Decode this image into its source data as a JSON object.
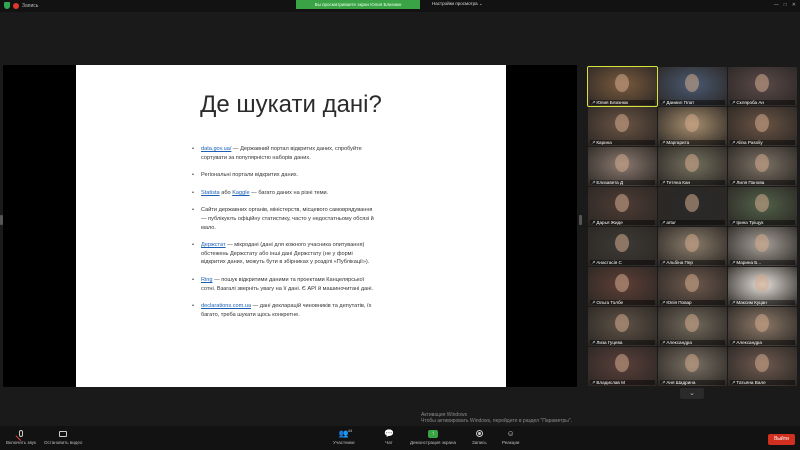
{
  "topbar": {
    "app_name": "Запись",
    "share_banner": "Вы просматриваете экран Юлия Близнюк",
    "view_options": "Настройки просмотра ⌄",
    "window_controls": [
      "—",
      "□",
      "✕"
    ]
  },
  "slide": {
    "title": "Де шукати дані?",
    "bullets": [
      {
        "link": "data.gov.ua/",
        "text": " — Державний портал відкритих даних, спробуйте сортувати за популярністю наборів даних."
      },
      {
        "link": "",
        "text": "Регіональні портали відкритих даних."
      },
      {
        "link": "Statista",
        "mid": " або ",
        "link2": "Kaggle",
        "text": " — багато даних на різні теми."
      },
      {
        "link": "",
        "text": "Сайти державних органів, міністерств, місцевого самоврядування — публікують офіційну статистику, часто у недостатньому обсязі й мало."
      },
      {
        "link": "Держстат",
        "text": " — мікродані (дані для кожного учасника опитування) обстежень Держстату або інші дані Держстату (не у формі відкритих даних, можуть бути в збірниках у розділі «Публікації»)."
      },
      {
        "link": "Ring",
        "text": " — пошук відкритими даними та проектами Канцелярської сотні. Взагалі зверніть увагу на її дані. Є API й машиночитані дані."
      },
      {
        "link": "declarations.com.ua",
        "text": " — дані декларацій чиновників та депутатів, їх багато, треба шукати щось конкретне."
      }
    ],
    "activation_line1": "Активация Windows",
    "activation_line2": "Чтобы активировать Windows, перейдите в раздел \"Параметры\"."
  },
  "participants": [
    {
      "name": "Юлия Близнюк",
      "color": "#7a5b3e",
      "active": true
    },
    {
      "name": "Даниил Плат",
      "color": "#4a5a72"
    },
    {
      "name": "Скляроба Ан",
      "color": "#5a4a4a"
    },
    {
      "name": "Карина",
      "color": "#6b5444"
    },
    {
      "name": "Маргарита",
      "color": "#a88f6f"
    },
    {
      "name": "Alina Pasoliy",
      "color": "#6a5444"
    },
    {
      "name": "Елизавета Д",
      "color": "#8b7a70"
    },
    {
      "name": "Тетяна Кан",
      "color": "#74705e"
    },
    {
      "name": "Лиля Панова",
      "color": "#7d7266"
    },
    {
      "name": "Дарья Жиде",
      "color": "#4e3c34"
    },
    {
      "name": "artur",
      "color": "#2a2a2a"
    },
    {
      "name": "Ірина Тріщук",
      "color": "#52624a"
    },
    {
      "name": "Анастасія С",
      "color": "#3d3a36"
    },
    {
      "name": "Альбіна Пер",
      "color": "#8a7c6a"
    },
    {
      "name": "Марина Б...",
      "color": "#a8a29a"
    },
    {
      "name": "Ольга Толбе",
      "color": "#5e3f36"
    },
    {
      "name": "Юлія Повар",
      "color": "#6e5a4e"
    },
    {
      "name": "Максим Куцан",
      "color": "#e7e2dc"
    },
    {
      "name": "Лиза Гуцева",
      "color": "#5e5246"
    },
    {
      "name": "Александра",
      "color": "#726a5c"
    },
    {
      "name": "Александра",
      "color": "#8c7968"
    },
    {
      "name": "Владислав М",
      "color": "#5a3f3a"
    },
    {
      "name": "Аня Шадрина",
      "color": "#7a7064"
    },
    {
      "name": "Татьяна Вале",
      "color": "#6e5a50"
    }
  ],
  "toolbar": {
    "unmute": "Включить звук",
    "start_video": "Остановить видео",
    "participants": "Участники",
    "participants_count": "44",
    "chat": "Чат",
    "share_screen": "Демонстрация экрана",
    "record": "Запись",
    "reactions": "Реакции",
    "leave": "Выйти"
  }
}
